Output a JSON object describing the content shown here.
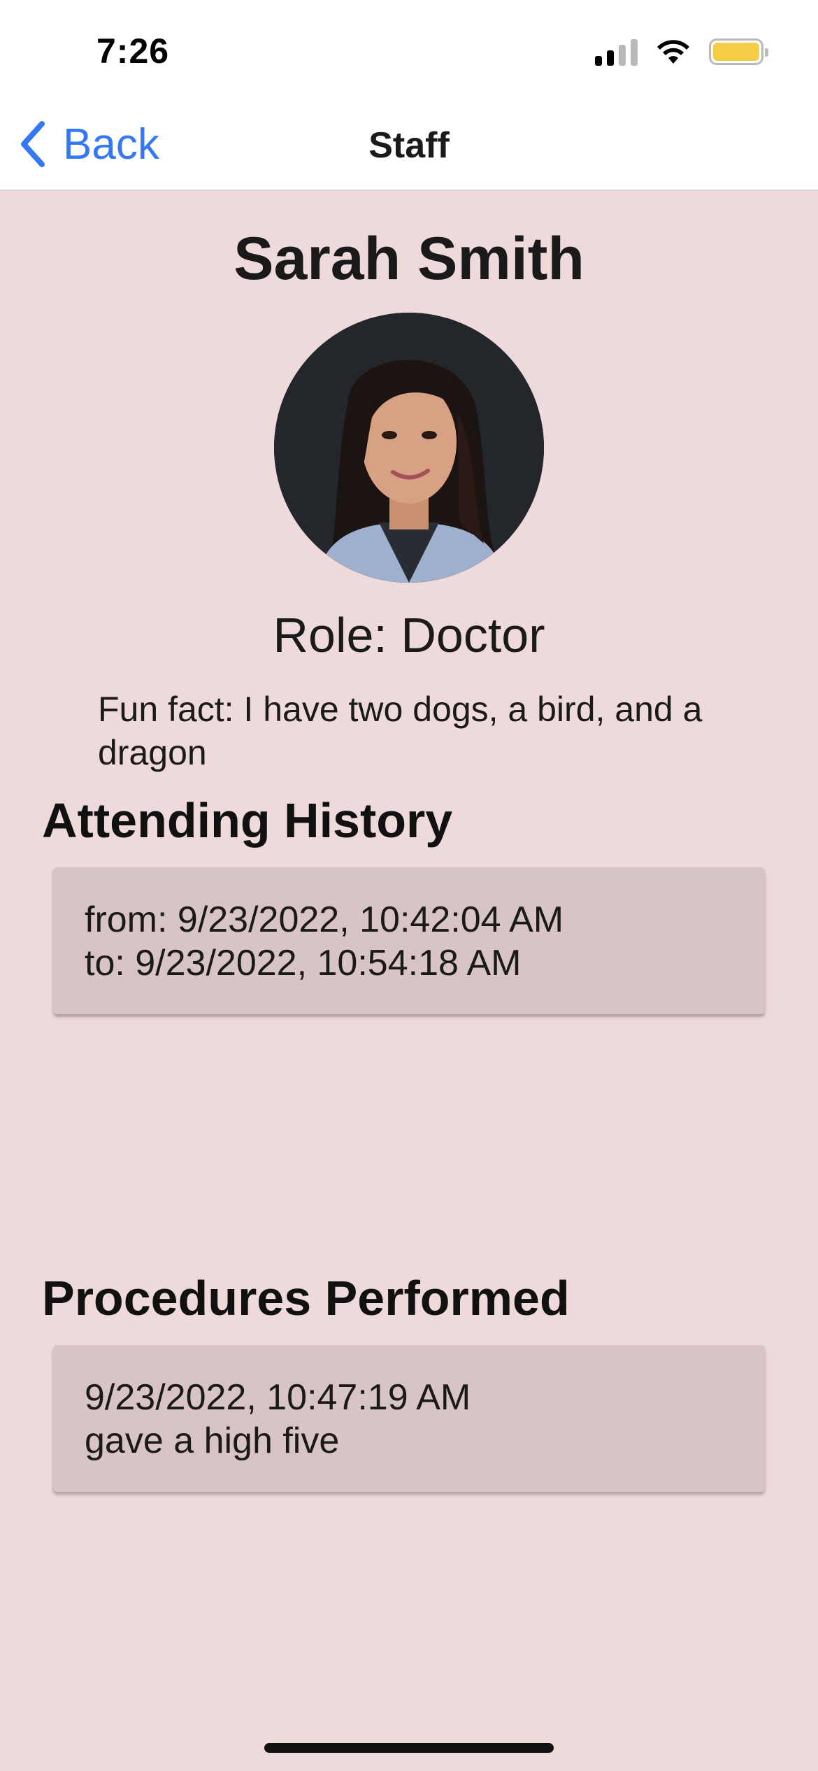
{
  "status_bar": {
    "time": "7:26",
    "battery_color": "#f5cd47"
  },
  "nav": {
    "back_label": "Back",
    "title": "Staff",
    "accent": "#3478f6"
  },
  "profile": {
    "name": "Sarah Smith",
    "role": "Role: Doctor",
    "fun_fact": "Fun fact: I have two dogs, a bird, and a dragon"
  },
  "attending_history": {
    "heading": "Attending History",
    "entries": [
      {
        "from": "from: 9/23/2022, 10:42:04 AM",
        "to": "to: 9/23/2022, 10:54:18 AM"
      }
    ]
  },
  "procedures": {
    "heading": "Procedures Performed",
    "entries": [
      {
        "time": "9/23/2022, 10:47:19 AM",
        "description": "gave a high five"
      }
    ]
  },
  "colors": {
    "background": "#efdadb",
    "card": "#d8c4c4"
  }
}
